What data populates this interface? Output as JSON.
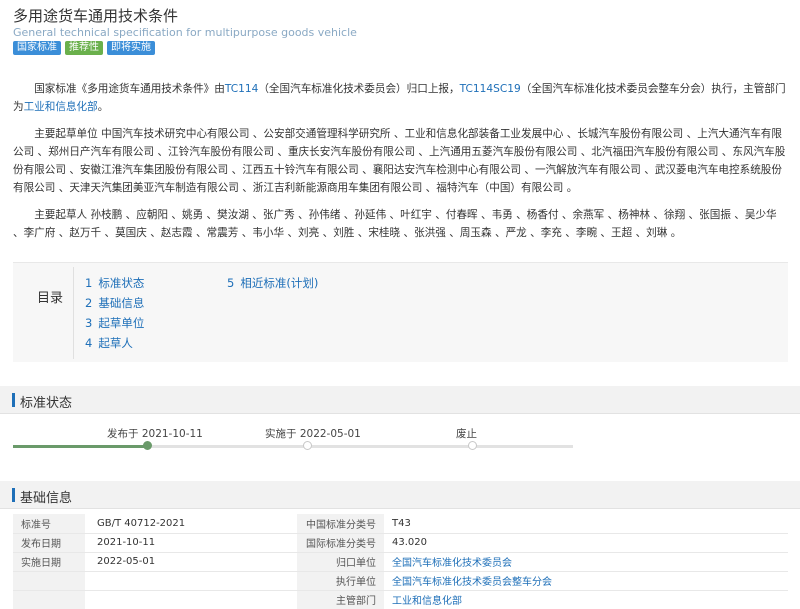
{
  "header": {
    "title": "多用途货车通用技术条件",
    "subtitle": "General technical specification for multipurpose goods vehicle",
    "tags": [
      "国家标准",
      "推荐性",
      "即将实施"
    ]
  },
  "intro": {
    "p1": {
      "t1": "国家标准《多用途货车通用技术条件》由",
      "link1": "TC114",
      "t2": "（全国汽车标准化技术委员会）归口上报，",
      "link2": "TC114SC19",
      "t3": "（全国汽车标准化技术委员会整车分会）执行，主管部门为",
      "link3": "工业和信息化部",
      "t4": "。"
    },
    "p2": "主要起草单位 中国汽车技术研究中心有限公司 、公安部交通管理科学研究所 、工业和信息化部装备工业发展中心 、长城汽车股份有限公司 、上汽大通汽车有限公司 、郑州日产汽车有限公司 、江铃汽车股份有限公司 、重庆长安汽车股份有限公司 、上汽通用五菱汽车股份有限公司 、北汽福田汽车股份有限公司 、东风汽车股份有限公司 、安徽江淮汽车集团股份有限公司 、江西五十铃汽车有限公司 、襄阳达安汽车检测中心有限公司 、一汽解放汽车有限公司 、武汉菱电汽车电控系统股份有限公司 、天津天汽集团美亚汽车制造有限公司 、浙江吉利新能源商用车集团有限公司 、福特汽车（中国）有限公司 。",
    "p3": "主要起草人 孙枝鹏 、应朝阳 、姚勇 、樊汝湖 、张广秀 、孙伟绪 、孙延伟 、叶红宇 、付春晖 、韦勇 、杨香付 、余燕军 、杨神林 、徐翔 、张国振 、吴少华 、李广府 、赵万千 、莫国庆 、赵志霞 、常震芳 、韦小华 、刘亮 、刘胜 、宋桂晓 、张洪强 、周玉森 、严龙 、李充 、李畹 、王超 、刘琳 。"
  },
  "toc": {
    "label": "目录",
    "items": [
      {
        "num": "1",
        "label": "标准状态"
      },
      {
        "num": "2",
        "label": "基础信息"
      },
      {
        "num": "3",
        "label": "起草单位"
      },
      {
        "num": "4",
        "label": "起草人"
      },
      {
        "num": "5",
        "label": "相近标准(计划)"
      }
    ]
  },
  "status_section": {
    "title": "标准状态",
    "milestones": [
      {
        "label": "发布于 2021-10-11",
        "state": "done"
      },
      {
        "label": "实施于 2022-05-01",
        "state": "pending"
      },
      {
        "label": "废止",
        "state": "pending"
      }
    ]
  },
  "basic_section": {
    "title": "基础信息",
    "rows": [
      {
        "l1": "标准号",
        "v1": "GB/T 40712-2021",
        "l2": "中国标准分类号",
        "v2": "T43",
        "v2_link": false
      },
      {
        "l1": "发布日期",
        "v1": "2021-10-11",
        "l2": "国际标准分类号",
        "v2": "43.020",
        "v2_link": false
      },
      {
        "l1": "实施日期",
        "v1": "2022-05-01",
        "l2": "归口单位",
        "v2": "全国汽车标准化技术委员会",
        "v2_link": true
      },
      {
        "l1": "",
        "v1": "",
        "l2": "执行单位",
        "v2": "全国汽车标准化技术委员会整车分会",
        "v2_link": true
      },
      {
        "l1": "",
        "v1": "",
        "l2": "主管部门",
        "v2": "工业和信息化部",
        "v2_link": true
      }
    ]
  },
  "colors": {
    "link": "#1e6fb8",
    "tag_blue": "#3b8ed8",
    "tag_green": "#6ab04c",
    "timeline_done": "#6a9a6a"
  }
}
